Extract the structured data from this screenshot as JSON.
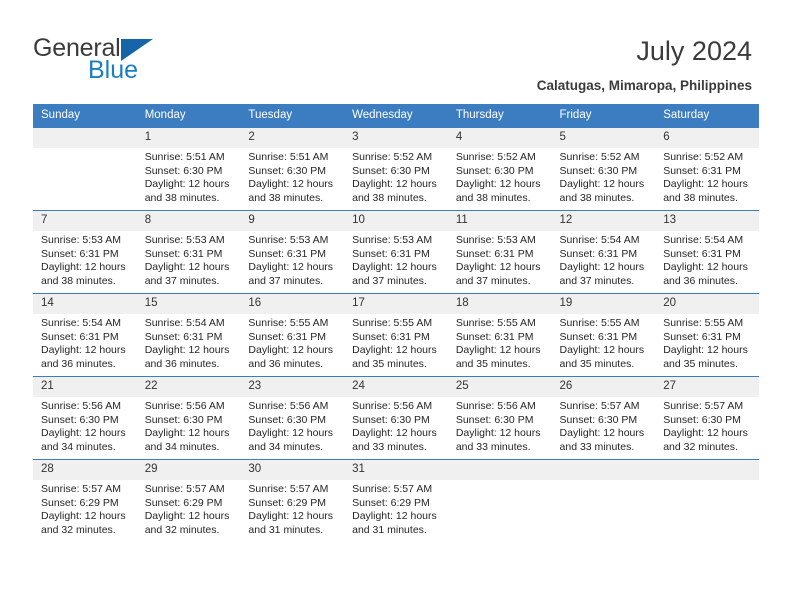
{
  "brand": {
    "name_part1": "General",
    "name_part2": "Blue",
    "triangle_color": "#1565a8",
    "blue_color": "#1a7fc1"
  },
  "header": {
    "title": "July 2024",
    "location": "Calatugas, Mimaropa, Philippines",
    "header_bg_color": "#3b7dc0"
  },
  "calendar": {
    "weekday_headers": [
      "Sunday",
      "Monday",
      "Tuesday",
      "Wednesday",
      "Thursday",
      "Friday",
      "Saturday"
    ],
    "labels": {
      "sunrise": "Sunrise:",
      "sunset": "Sunset:",
      "daylight": "Daylight:"
    },
    "weeks": [
      [
        {
          "day": "",
          "empty": true
        },
        {
          "day": "1",
          "sunrise": "Sunrise: 5:51 AM",
          "sunset": "Sunset: 6:30 PM",
          "daylight": "Daylight: 12 hours and 38 minutes."
        },
        {
          "day": "2",
          "sunrise": "Sunrise: 5:51 AM",
          "sunset": "Sunset: 6:30 PM",
          "daylight": "Daylight: 12 hours and 38 minutes."
        },
        {
          "day": "3",
          "sunrise": "Sunrise: 5:52 AM",
          "sunset": "Sunset: 6:30 PM",
          "daylight": "Daylight: 12 hours and 38 minutes."
        },
        {
          "day": "4",
          "sunrise": "Sunrise: 5:52 AM",
          "sunset": "Sunset: 6:30 PM",
          "daylight": "Daylight: 12 hours and 38 minutes."
        },
        {
          "day": "5",
          "sunrise": "Sunrise: 5:52 AM",
          "sunset": "Sunset: 6:30 PM",
          "daylight": "Daylight: 12 hours and 38 minutes."
        },
        {
          "day": "6",
          "sunrise": "Sunrise: 5:52 AM",
          "sunset": "Sunset: 6:31 PM",
          "daylight": "Daylight: 12 hours and 38 minutes."
        }
      ],
      [
        {
          "day": "7",
          "sunrise": "Sunrise: 5:53 AM",
          "sunset": "Sunset: 6:31 PM",
          "daylight": "Daylight: 12 hours and 38 minutes."
        },
        {
          "day": "8",
          "sunrise": "Sunrise: 5:53 AM",
          "sunset": "Sunset: 6:31 PM",
          "daylight": "Daylight: 12 hours and 37 minutes."
        },
        {
          "day": "9",
          "sunrise": "Sunrise: 5:53 AM",
          "sunset": "Sunset: 6:31 PM",
          "daylight": "Daylight: 12 hours and 37 minutes."
        },
        {
          "day": "10",
          "sunrise": "Sunrise: 5:53 AM",
          "sunset": "Sunset: 6:31 PM",
          "daylight": "Daylight: 12 hours and 37 minutes."
        },
        {
          "day": "11",
          "sunrise": "Sunrise: 5:53 AM",
          "sunset": "Sunset: 6:31 PM",
          "daylight": "Daylight: 12 hours and 37 minutes."
        },
        {
          "day": "12",
          "sunrise": "Sunrise: 5:54 AM",
          "sunset": "Sunset: 6:31 PM",
          "daylight": "Daylight: 12 hours and 37 minutes."
        },
        {
          "day": "13",
          "sunrise": "Sunrise: 5:54 AM",
          "sunset": "Sunset: 6:31 PM",
          "daylight": "Daylight: 12 hours and 36 minutes."
        }
      ],
      [
        {
          "day": "14",
          "sunrise": "Sunrise: 5:54 AM",
          "sunset": "Sunset: 6:31 PM",
          "daylight": "Daylight: 12 hours and 36 minutes."
        },
        {
          "day": "15",
          "sunrise": "Sunrise: 5:54 AM",
          "sunset": "Sunset: 6:31 PM",
          "daylight": "Daylight: 12 hours and 36 minutes."
        },
        {
          "day": "16",
          "sunrise": "Sunrise: 5:55 AM",
          "sunset": "Sunset: 6:31 PM",
          "daylight": "Daylight: 12 hours and 36 minutes."
        },
        {
          "day": "17",
          "sunrise": "Sunrise: 5:55 AM",
          "sunset": "Sunset: 6:31 PM",
          "daylight": "Daylight: 12 hours and 35 minutes."
        },
        {
          "day": "18",
          "sunrise": "Sunrise: 5:55 AM",
          "sunset": "Sunset: 6:31 PM",
          "daylight": "Daylight: 12 hours and 35 minutes."
        },
        {
          "day": "19",
          "sunrise": "Sunrise: 5:55 AM",
          "sunset": "Sunset: 6:31 PM",
          "daylight": "Daylight: 12 hours and 35 minutes."
        },
        {
          "day": "20",
          "sunrise": "Sunrise: 5:55 AM",
          "sunset": "Sunset: 6:31 PM",
          "daylight": "Daylight: 12 hours and 35 minutes."
        }
      ],
      [
        {
          "day": "21",
          "sunrise": "Sunrise: 5:56 AM",
          "sunset": "Sunset: 6:30 PM",
          "daylight": "Daylight: 12 hours and 34 minutes."
        },
        {
          "day": "22",
          "sunrise": "Sunrise: 5:56 AM",
          "sunset": "Sunset: 6:30 PM",
          "daylight": "Daylight: 12 hours and 34 minutes."
        },
        {
          "day": "23",
          "sunrise": "Sunrise: 5:56 AM",
          "sunset": "Sunset: 6:30 PM",
          "daylight": "Daylight: 12 hours and 34 minutes."
        },
        {
          "day": "24",
          "sunrise": "Sunrise: 5:56 AM",
          "sunset": "Sunset: 6:30 PM",
          "daylight": "Daylight: 12 hours and 33 minutes."
        },
        {
          "day": "25",
          "sunrise": "Sunrise: 5:56 AM",
          "sunset": "Sunset: 6:30 PM",
          "daylight": "Daylight: 12 hours and 33 minutes."
        },
        {
          "day": "26",
          "sunrise": "Sunrise: 5:57 AM",
          "sunset": "Sunset: 6:30 PM",
          "daylight": "Daylight: 12 hours and 33 minutes."
        },
        {
          "day": "27",
          "sunrise": "Sunrise: 5:57 AM",
          "sunset": "Sunset: 6:30 PM",
          "daylight": "Daylight: 12 hours and 32 minutes."
        }
      ],
      [
        {
          "day": "28",
          "sunrise": "Sunrise: 5:57 AM",
          "sunset": "Sunset: 6:29 PM",
          "daylight": "Daylight: 12 hours and 32 minutes."
        },
        {
          "day": "29",
          "sunrise": "Sunrise: 5:57 AM",
          "sunset": "Sunset: 6:29 PM",
          "daylight": "Daylight: 12 hours and 32 minutes."
        },
        {
          "day": "30",
          "sunrise": "Sunrise: 5:57 AM",
          "sunset": "Sunset: 6:29 PM",
          "daylight": "Daylight: 12 hours and 31 minutes."
        },
        {
          "day": "31",
          "sunrise": "Sunrise: 5:57 AM",
          "sunset": "Sunset: 6:29 PM",
          "daylight": "Daylight: 12 hours and 31 minutes."
        },
        {
          "day": "",
          "empty": true
        },
        {
          "day": "",
          "empty": true
        },
        {
          "day": "",
          "empty": true
        }
      ]
    ]
  }
}
